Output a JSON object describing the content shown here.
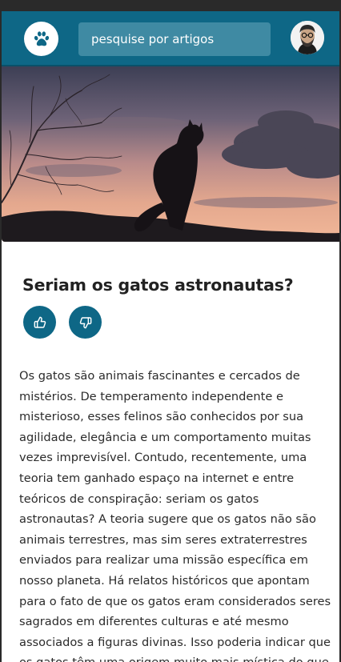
{
  "header": {
    "logo_icon": "paw-icon",
    "search_placeholder": "pesquise por artigos",
    "avatar_icon": "user-avatar",
    "bar_color": "#0e6786"
  },
  "hero": {
    "image": "cat-silhouette-sunset"
  },
  "article": {
    "title": "Seriam os gatos astronautas?",
    "like_icon": "thumbs-up-icon",
    "dislike_icon": "thumbs-down-icon",
    "body": "Os gatos são animais fascinantes e cercados de mistérios. De temperamento independente e misterioso, esses felinos são conhecidos por sua agilidade, elegância e um comportamento muitas vezes imprevisível. Contudo, recentemente, uma teoria tem ganhado espaço na internet e entre teóricos de conspiração: seriam os gatos astronautas? A teoria sugere que os gatos não são animais terrestres, mas sim seres extraterrestres enviados para realizar uma missão específica em nosso planeta. Há relatos históricos que apontam para o fato de que os gatos eram considerados seres sagrados em diferentes culturas e até mesmo associados a figuras divinas. Isso poderia indicar que os gatos têm uma origem muito mais mística do que imaginamos."
  }
}
